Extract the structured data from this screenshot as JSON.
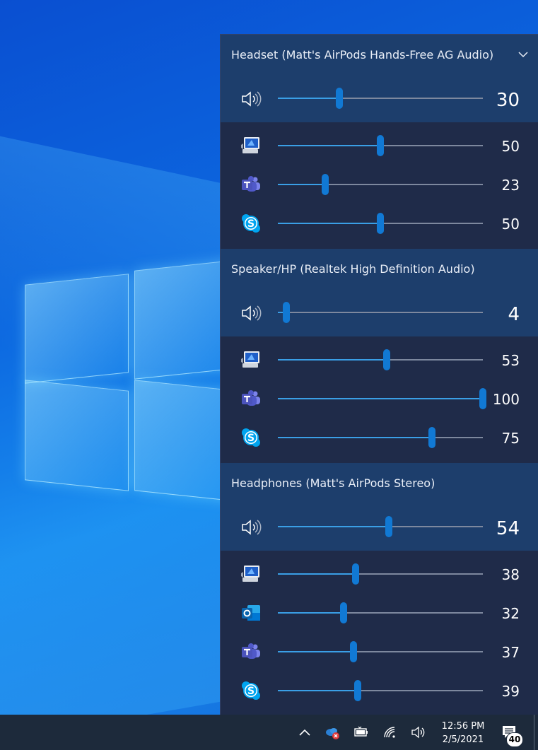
{
  "devices": [
    {
      "name": "Headset (Matt's AirPods Hands-Free AG Audio)",
      "has_chevron": true,
      "master": {
        "icon": "speaker-icon",
        "value": 30,
        "label": "30"
      },
      "apps": [
        {
          "icon": "system-sounds-icon",
          "value": 50,
          "label": "50"
        },
        {
          "icon": "teams-icon",
          "value": 23,
          "label": "23"
        },
        {
          "icon": "skype-icon",
          "value": 50,
          "label": "50"
        }
      ]
    },
    {
      "name": "Speaker/HP (Realtek High Definition Audio)",
      "has_chevron": false,
      "master": {
        "icon": "speaker-icon",
        "value": 4,
        "label": "4"
      },
      "apps": [
        {
          "icon": "system-sounds-icon",
          "value": 53,
          "label": "53"
        },
        {
          "icon": "teams-icon",
          "value": 100,
          "label": "100"
        },
        {
          "icon": "skype-icon",
          "value": 75,
          "label": "75"
        }
      ]
    },
    {
      "name": "Headphones (Matt's AirPods Stereo)",
      "has_chevron": false,
      "master": {
        "icon": "speaker-icon",
        "value": 54,
        "label": "54"
      },
      "apps": [
        {
          "icon": "system-sounds-icon",
          "value": 38,
          "label": "38"
        },
        {
          "icon": "outlook-icon",
          "value": 32,
          "label": "32"
        },
        {
          "icon": "teams-icon",
          "value": 37,
          "label": "37"
        },
        {
          "icon": "skype-icon",
          "value": 39,
          "label": "39"
        }
      ]
    }
  ],
  "taskbar": {
    "time": "12:56 PM",
    "date": "2/5/2021",
    "notification_count": "40",
    "tray_icons": [
      "chevron-up-icon",
      "onedrive-error-icon",
      "battery-icon",
      "wifi-icon",
      "volume-icon"
    ]
  },
  "colors": {
    "flyout_bg": "#1f2c4a",
    "device_header_bg": "#1d3e6c",
    "slider_fill": "#3a9fe6",
    "slider_thumb": "#1179d4",
    "taskbar_bg": "#1d2a3b"
  }
}
